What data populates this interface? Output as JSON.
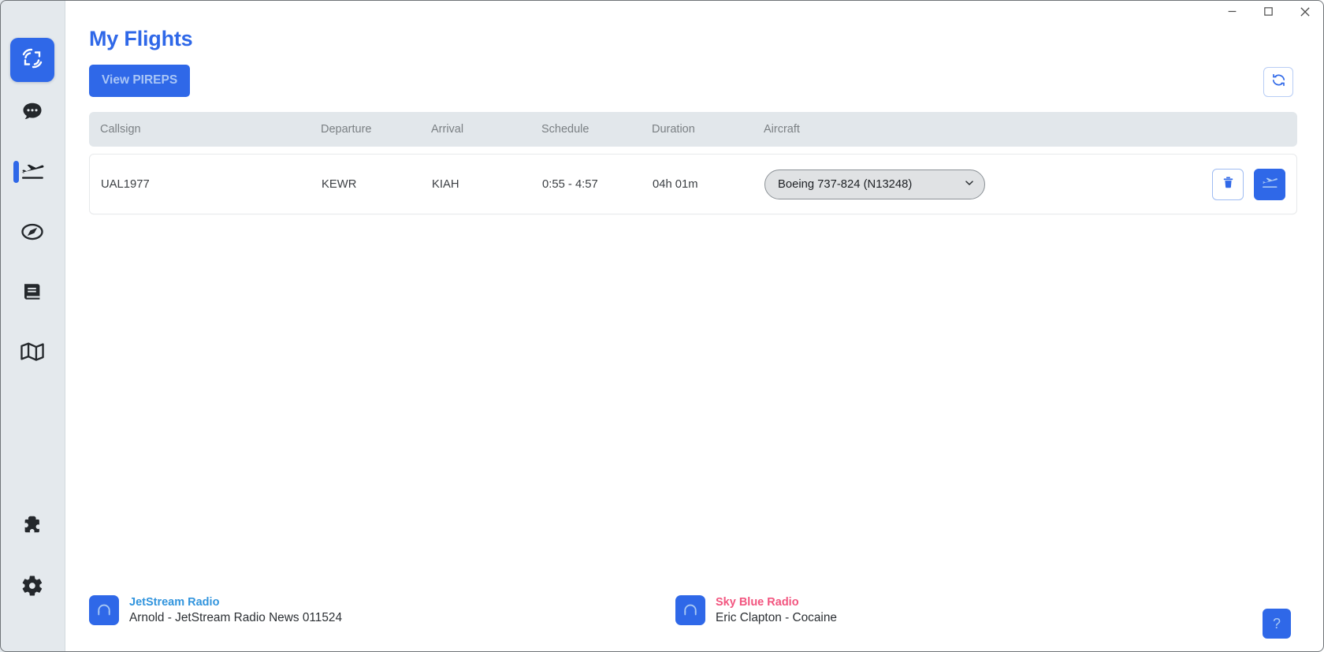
{
  "window": {
    "controls": [
      {
        "name": "minimize",
        "glyph": "minimize-icon"
      },
      {
        "name": "maximize",
        "glyph": "maximize-icon"
      },
      {
        "name": "close",
        "glyph": "close-icon"
      }
    ]
  },
  "sidebar": {
    "logo_label": "sc-logo",
    "items": [
      {
        "icon": "chat-bubble-icon",
        "label": "Chat",
        "active": false
      },
      {
        "icon": "plane-departure-icon",
        "label": "My Flights",
        "active": true
      },
      {
        "icon": "compass-icon",
        "label": "Explore",
        "active": false
      },
      {
        "icon": "book-icon",
        "label": "Logbook",
        "active": false
      },
      {
        "icon": "map-icon",
        "label": "Map",
        "active": false
      }
    ],
    "bottom_items": [
      {
        "icon": "puzzle-piece-icon",
        "label": "Plugins",
        "active": false
      },
      {
        "icon": "gear-icon",
        "label": "Settings",
        "active": false
      }
    ]
  },
  "header": {
    "title": "My Flights",
    "pireps_button": "View PIREPS",
    "refresh_icon": "refresh-icon"
  },
  "table": {
    "columns": [
      "Callsign",
      "Departure",
      "Arrival",
      "Schedule",
      "Duration",
      "Aircraft"
    ],
    "rows": [
      {
        "callsign": "UAL1977",
        "departure": "KEWR",
        "arrival": "KIAH",
        "schedule": "0:55 - 4:57",
        "duration": "04h 01m",
        "aircraft_selected": "Boeing 737-824 (N13248)",
        "aircraft_options": [
          "Boeing 737-824 (N13248)"
        ],
        "delete_icon": "trash-icon",
        "fly_icon": "plane-departure-icon"
      }
    ]
  },
  "footer": {
    "radios": [
      {
        "icon": "headphones-icon",
        "station": "JetStream Radio",
        "now_playing": "Arnold - JetStream Radio News 011524"
      },
      {
        "icon": "headphones-icon",
        "station": "Sky Blue Radio",
        "now_playing": "Eric Clapton - Cocaine"
      }
    ],
    "help_button": "?"
  },
  "colors": {
    "accent": "#2f68e8",
    "rail_bg": "#e4e9ed",
    "table_header_bg": "#e2e7eb",
    "jetstream": "#3194dd",
    "skyblue": "#f2557f"
  }
}
